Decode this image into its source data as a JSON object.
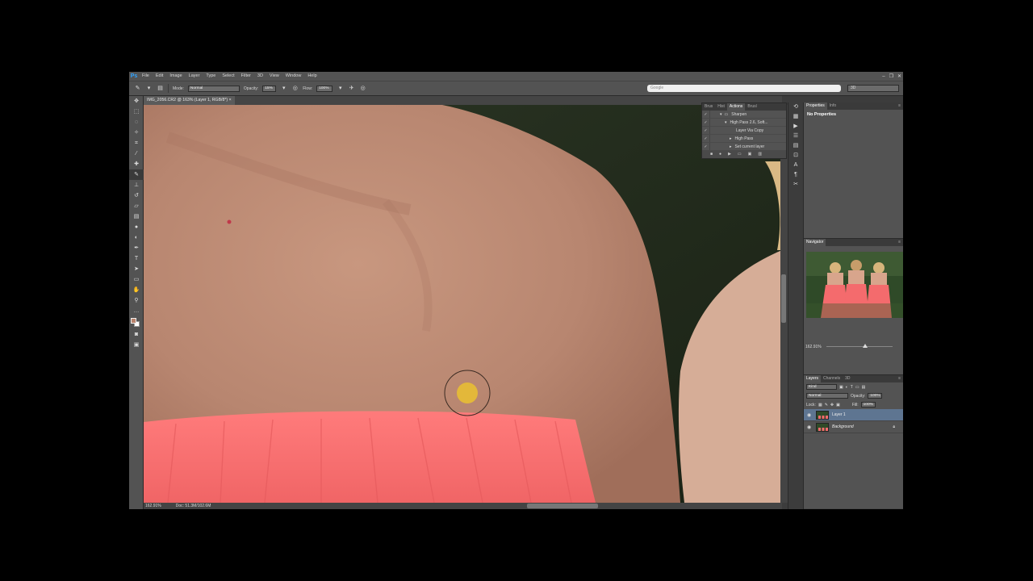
{
  "app": {
    "logo": "Ps",
    "menu": [
      "File",
      "Edit",
      "Image",
      "Layer",
      "Type",
      "Select",
      "Filter",
      "3D",
      "View",
      "Window",
      "Help"
    ],
    "window_controls": [
      "–",
      "❐",
      "✕"
    ]
  },
  "options_bar": {
    "mode_label": "Mode:",
    "mode_value": "Normal",
    "opacity_label": "Opacity:",
    "opacity_value": "15%",
    "flow_label": "Flow:",
    "flow_value": "100%",
    "search_placeholder": "Google",
    "workspace_value": "3D"
  },
  "document": {
    "tab_title": "IMG_2056.CR2 @ 163% (Layer 1, RGB/8*)",
    "tab_close": "×",
    "zoom": "162.91%",
    "doc_size": "Doc: 51.3M/102.6M"
  },
  "actions_panel": {
    "tabs": [
      "Brus",
      "Hist",
      "Actions",
      "Brusl"
    ],
    "active_tab": "Actions",
    "rows": [
      {
        "check": "✓",
        "label": "Sharpen",
        "indent": 0
      },
      {
        "check": "✓",
        "label": "High Pass 2.6, Soft...",
        "indent": 1
      },
      {
        "check": "✓",
        "label": "Layer Via Copy",
        "indent": 2
      },
      {
        "check": "✓",
        "label": "High Pass",
        "indent": 2
      },
      {
        "check": "✓",
        "label": "Set current layer",
        "indent": 2
      }
    ]
  },
  "properties_panel": {
    "tabs": [
      "Properties",
      "Info"
    ],
    "active_tab": "Properties",
    "body_text": "No Properties"
  },
  "navigator_panel": {
    "title": "Navigator",
    "zoom": "162.91%"
  },
  "layers_panel": {
    "tabs": [
      "Layers",
      "Channels",
      "3D"
    ],
    "active_tab": "Layers",
    "kind_label": "Kind",
    "blend_mode": "Normal",
    "opacity_label": "Opacity:",
    "opacity_value": "100%",
    "lock_label": "Lock:",
    "fill_label": "Fill:",
    "fill_value": "100%",
    "layers": [
      {
        "name": "Layer 1",
        "selected": true,
        "visible": true
      },
      {
        "name": "Background",
        "selected": false,
        "visible": true,
        "locked": true
      }
    ]
  },
  "colors": {
    "foreground": "#b9836c",
    "background": "#ffffff",
    "brush_cursor_fill": "#e3b83a",
    "selection_highlight": "#5e7591"
  }
}
